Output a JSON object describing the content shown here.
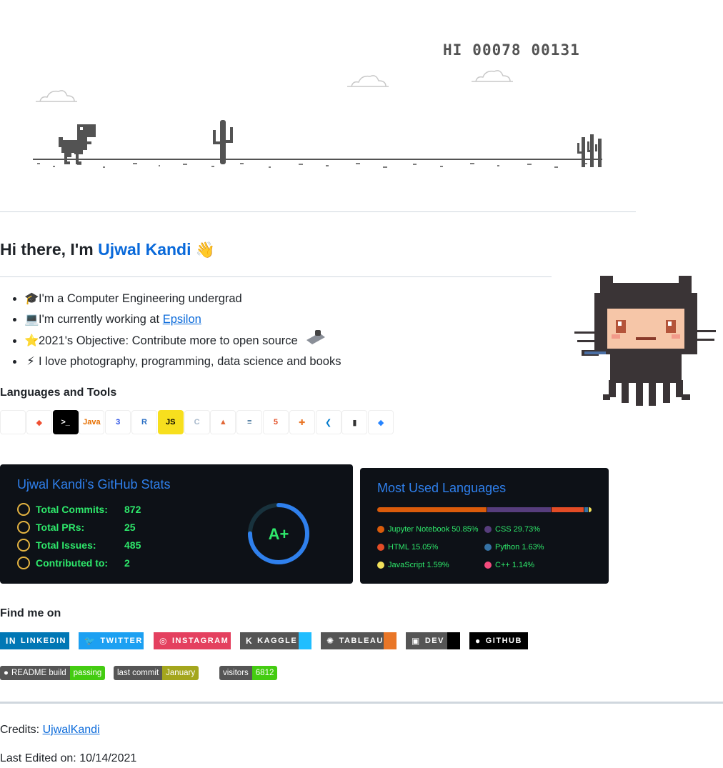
{
  "dino": {
    "hi_label": "HI",
    "hi_score": "00078",
    "score": "00131"
  },
  "greeting": {
    "prefix": "Hi there, I'm ",
    "name": "Ujwal Kandi",
    "wave_icon": "waving-hand-icon"
  },
  "about": [
    {
      "icon": "graduation-cap-icon",
      "emoji": "🎓",
      "text": "I'm a Computer Engineering undergrad"
    },
    {
      "icon": "laptop-icon",
      "emoji": "💻",
      "text_before": "I'm currently working at ",
      "link": "Epsilon"
    },
    {
      "icon": "star-icon",
      "emoji": "⭐",
      "text": "2021's Objective: Contribute more to open source"
    },
    {
      "icon": "lightning-icon",
      "emoji": "⚡",
      "text": "I love photography, programming, data science and books"
    }
  ],
  "tools_heading": "Languages and Tools",
  "tools": [
    {
      "name": "python-icon",
      "glyph": "",
      "bg": "#ffffff",
      "fg": "#3776ab"
    },
    {
      "name": "git-icon",
      "glyph": "◆",
      "bg": "#ffffff",
      "fg": "#f05032"
    },
    {
      "name": "terminal-icon",
      "glyph": ">_",
      "bg": "#000000",
      "fg": "#ffffff"
    },
    {
      "name": "java-icon",
      "glyph": "Java",
      "bg": "#ffffff",
      "fg": "#e76f00"
    },
    {
      "name": "css3-icon",
      "glyph": "3",
      "bg": "#ffffff",
      "fg": "#264de4"
    },
    {
      "name": "r-icon",
      "glyph": "R",
      "bg": "#ffffff",
      "fg": "#276dc3"
    },
    {
      "name": "javascript-icon",
      "glyph": "JS",
      "bg": "#f7df1e",
      "fg": "#000000"
    },
    {
      "name": "c-icon",
      "glyph": "C",
      "bg": "#ffffff",
      "fg": "#a8b9cc"
    },
    {
      "name": "matlab-icon",
      "glyph": "▲",
      "bg": "#ffffff",
      "fg": "#e16737"
    },
    {
      "name": "database-icon",
      "glyph": "≡",
      "bg": "#ffffff",
      "fg": "#336791"
    },
    {
      "name": "html5-icon",
      "glyph": "5",
      "bg": "#ffffff",
      "fg": "#e34f26"
    },
    {
      "name": "tableau-icon",
      "glyph": "✚",
      "bg": "#ffffff",
      "fg": "#e97627"
    },
    {
      "name": "vscode-icon",
      "glyph": "❮",
      "bg": "#ffffff",
      "fg": "#007acc"
    },
    {
      "name": "powerbi-icon",
      "glyph": "▮",
      "bg": "#ffffff",
      "fg": "#333333"
    },
    {
      "name": "jira-icon",
      "glyph": "◆",
      "bg": "#ffffff",
      "fg": "#2684ff"
    }
  ],
  "stats_card": {
    "title": "Ujwal Kandi's GitHub Stats",
    "rows": [
      {
        "icon": "clock-icon",
        "label": "Total Commits:",
        "value": "872"
      },
      {
        "icon": "pull-request-icon",
        "label": "Total PRs:",
        "value": "25"
      },
      {
        "icon": "issue-icon",
        "label": "Total Issues:",
        "value": "485"
      },
      {
        "icon": "repo-icon",
        "label": "Contributed to:",
        "value": "2"
      }
    ],
    "grade": "A+",
    "colors": {
      "title": "#2f80ed",
      "text": "#2ee86b",
      "icon": "#e3b341",
      "bg": "#0d1117"
    }
  },
  "languages_card": {
    "title": "Most Used Languages",
    "languages": [
      {
        "name": "Jupyter Notebook",
        "percent": "50.85%",
        "value": 50.85,
        "color": "#da5b0b"
      },
      {
        "name": "CSS",
        "percent": "29.73%",
        "value": 29.73,
        "color": "#563d7c"
      },
      {
        "name": "HTML",
        "percent": "15.05%",
        "value": 15.05,
        "color": "#e34c26"
      },
      {
        "name": "Python",
        "percent": "1.63%",
        "value": 1.63,
        "color": "#3572a5"
      },
      {
        "name": "JavaScript",
        "percent": "1.59%",
        "value": 1.59,
        "color": "#f1e05a"
      },
      {
        "name": "C++",
        "percent": "1.14%",
        "value": 1.14,
        "color": "#f34b7d"
      }
    ]
  },
  "find_heading": "Find me on",
  "social": [
    {
      "name": "linkedin-badge",
      "icon": "linkedin-icon",
      "glyph": "in",
      "label": "LinkedIn",
      "bg": "#0077b5",
      "tail": ""
    },
    {
      "name": "twitter-badge",
      "icon": "twitter-icon",
      "glyph": "🐦",
      "label": "Twitter",
      "bg": "#1ca0f2",
      "tail": ""
    },
    {
      "name": "instagram-badge",
      "icon": "instagram-icon",
      "glyph": "◎",
      "label": "Instagram",
      "bg": "#e4405f",
      "tail": ""
    },
    {
      "name": "kaggle-badge",
      "icon": "kaggle-icon",
      "glyph": "k",
      "label": "Kaggle",
      "bg": "#555555",
      "tail": "#20beff"
    },
    {
      "name": "tableau-badge",
      "icon": "tableau-icon",
      "glyph": "✺",
      "label": "Tableau",
      "bg": "#555555",
      "tail": "#e97627"
    },
    {
      "name": "dev-badge",
      "icon": "dev-icon",
      "glyph": "▣",
      "label": "Dev",
      "bg": "#555555",
      "tail": "#000000"
    },
    {
      "name": "github-badge",
      "icon": "github-icon",
      "glyph": "●",
      "label": "GitHub",
      "bg": "#000000",
      "tail": ""
    }
  ],
  "status_badges": [
    {
      "name": "readme-build-badge",
      "icon": "github-icon",
      "left": "README build",
      "right": "passing",
      "color": "#4c1"
    },
    {
      "name": "last-commit-badge",
      "icon": "",
      "left": "last commit",
      "right": "January",
      "color": "#a4a61d"
    },
    {
      "name": "visitors-badge",
      "icon": "",
      "left": "visitors",
      "right": "6812",
      "color": "#4c1"
    }
  ],
  "credits": {
    "label": "Credits: ",
    "link": "UjwalKandi"
  },
  "last_edited": "Last Edited on: 10/14/2021"
}
